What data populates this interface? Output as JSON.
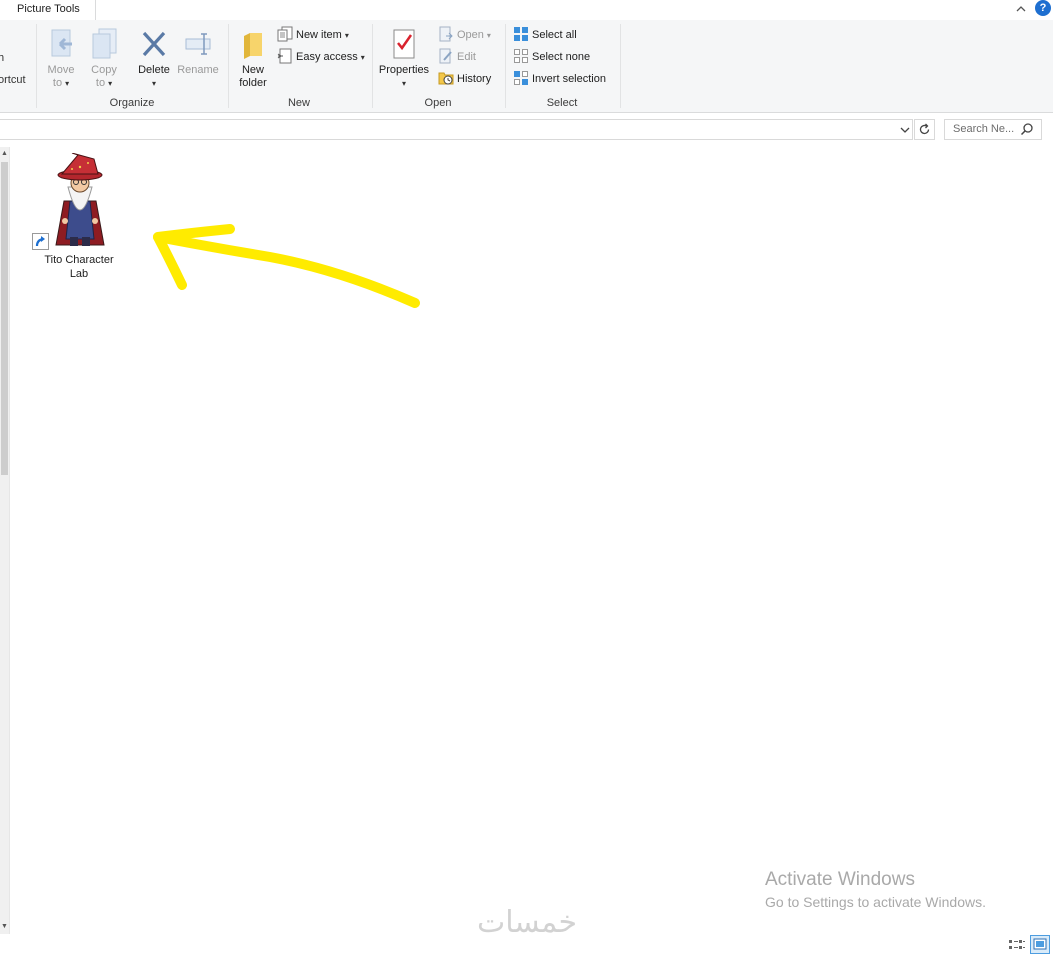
{
  "titlebar": {
    "context_tab": "Picture Tools",
    "collapse_caret": "^",
    "help": "?"
  },
  "ribbon": {
    "clipped_left": {
      "line1": "h",
      "line2": "ortcut"
    },
    "organize": {
      "label": "Organize",
      "move_to": {
        "line1": "Move",
        "line2": "to"
      },
      "copy_to": {
        "line1": "Copy",
        "line2": "to"
      },
      "delete": "Delete",
      "rename": "Rename"
    },
    "new": {
      "label": "New",
      "new_folder": {
        "line1": "New",
        "line2": "folder"
      },
      "new_item": "New item",
      "easy_access": "Easy access"
    },
    "open": {
      "label": "Open",
      "properties": "Properties",
      "open": "Open",
      "edit": "Edit",
      "history": "History"
    },
    "select": {
      "label": "Select",
      "select_all": "Select all",
      "select_none": "Select none",
      "invert_selection": "Invert selection"
    }
  },
  "addressbar": {
    "path": "",
    "search_placeholder": "Search Ne..."
  },
  "content": {
    "items": [
      {
        "name_line1": "Tito Character",
        "name_line2": "Lab",
        "icon": "wizard-icon",
        "shortcut": true
      }
    ]
  },
  "overlay": {
    "activate_title": "Activate Windows",
    "activate_sub": "Go to Settings to activate Windows.",
    "watermark": "خمسات",
    "annotation_arrow_color": "#ffeb00"
  },
  "colors": {
    "ribbon_bg": "#f5f6f7",
    "accent": "#1e6fd0",
    "delete_x": "#2b579a",
    "folder": "#f3c74a",
    "properties_check": "#d9232e"
  }
}
